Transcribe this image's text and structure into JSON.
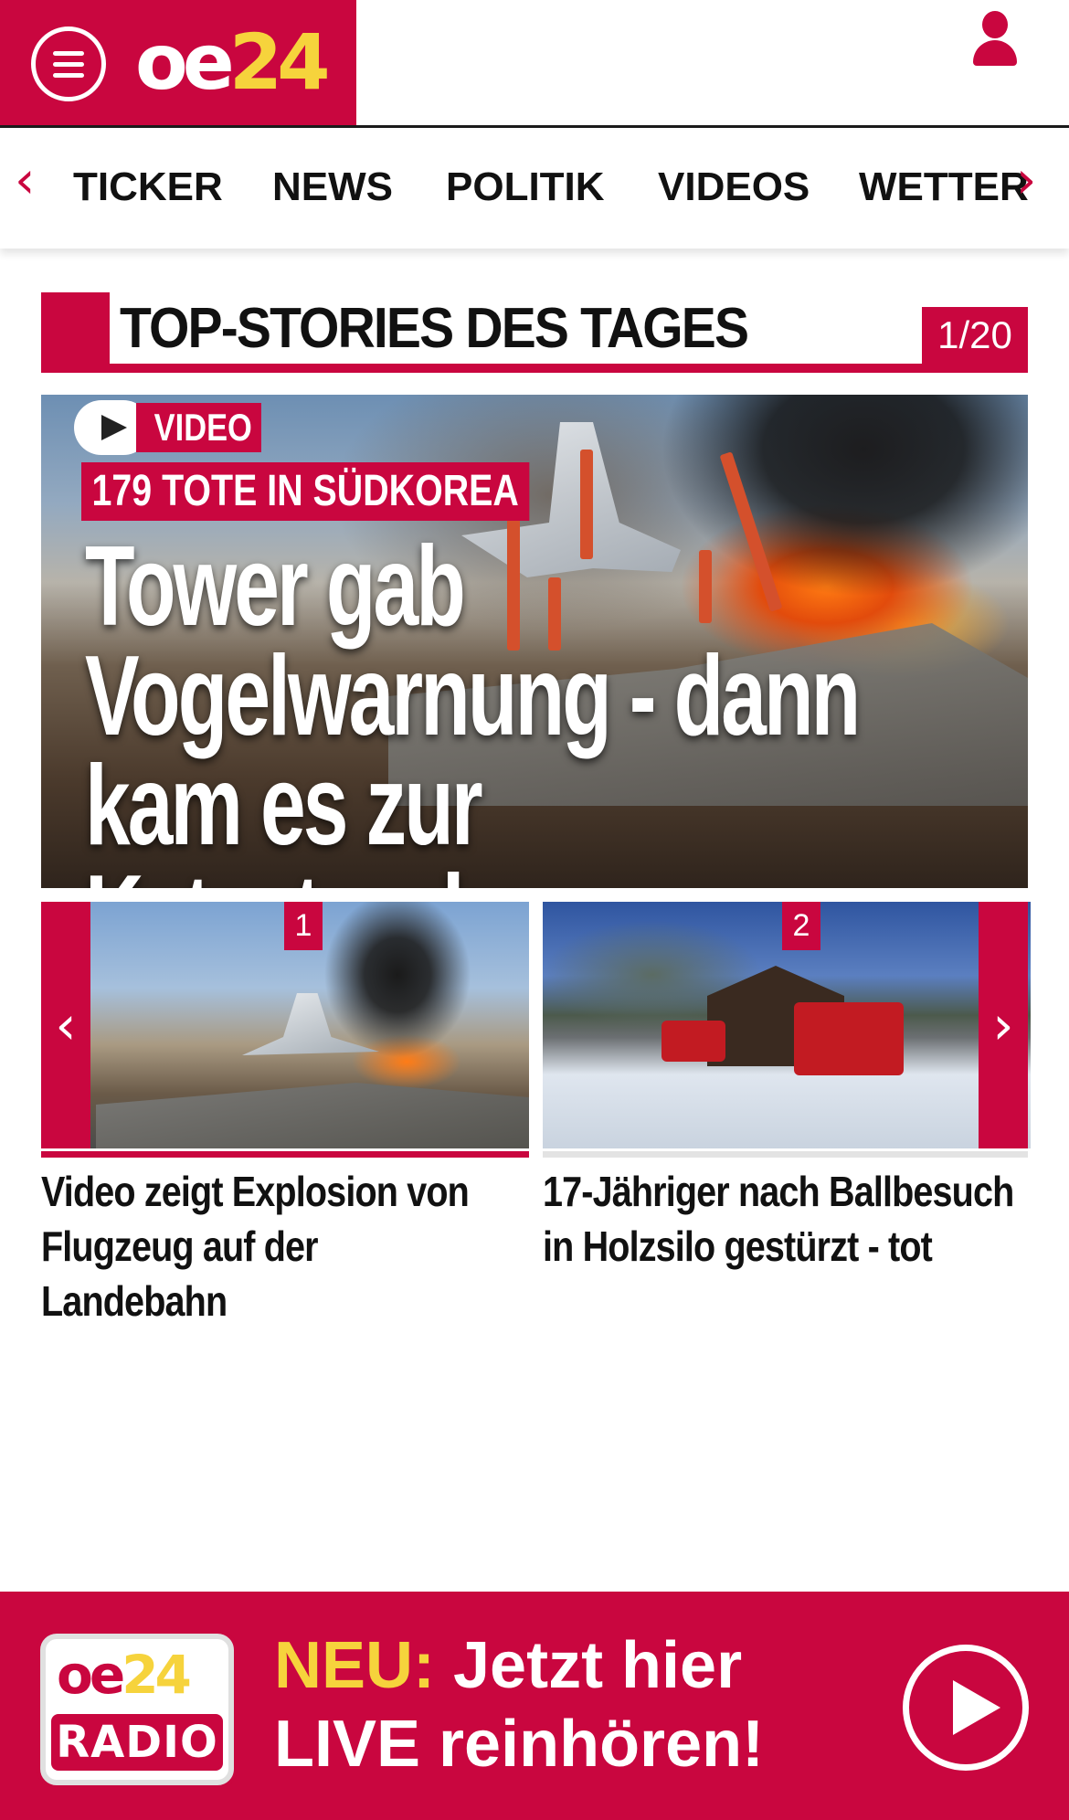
{
  "header": {
    "logo_oe": "oe",
    "logo_24": "24"
  },
  "nav": {
    "items": [
      "TICKER",
      "NEWS",
      "POLITIK",
      "VIDEOS",
      "WETTER"
    ]
  },
  "section": {
    "title": "TOP-STORIES DES TAGES",
    "counter": "1/20"
  },
  "hero": {
    "badge": "VIDEO",
    "kicker": "179 TOTE IN SÜDKOREA",
    "headline_line1": "Tower gab",
    "headline_line2": "Vogelwarnung - dann",
    "headline_line3": "kam es zur Katastrophe"
  },
  "stories": [
    {
      "number": "1",
      "title": "Video zeigt Explosion von Flugzeug auf der Landebahn"
    },
    {
      "number": "2",
      "title": "17-Jähriger nach Ballbesuch in Holzsilo gestürzt - tot"
    }
  ],
  "radio": {
    "logo_oe": "oe",
    "logo_24": "24",
    "logo_radio": "RADIO",
    "neu": "NEU:",
    "line1_rest": " Jetzt hier",
    "line2": "LIVE reinhören!"
  },
  "colors": {
    "brand_red": "#c9063f",
    "brand_yellow": "#f6d33c"
  },
  "icons": [
    "menu-icon",
    "user-icon",
    "chevron-left-icon",
    "chevron-right-icon",
    "play-icon"
  ]
}
